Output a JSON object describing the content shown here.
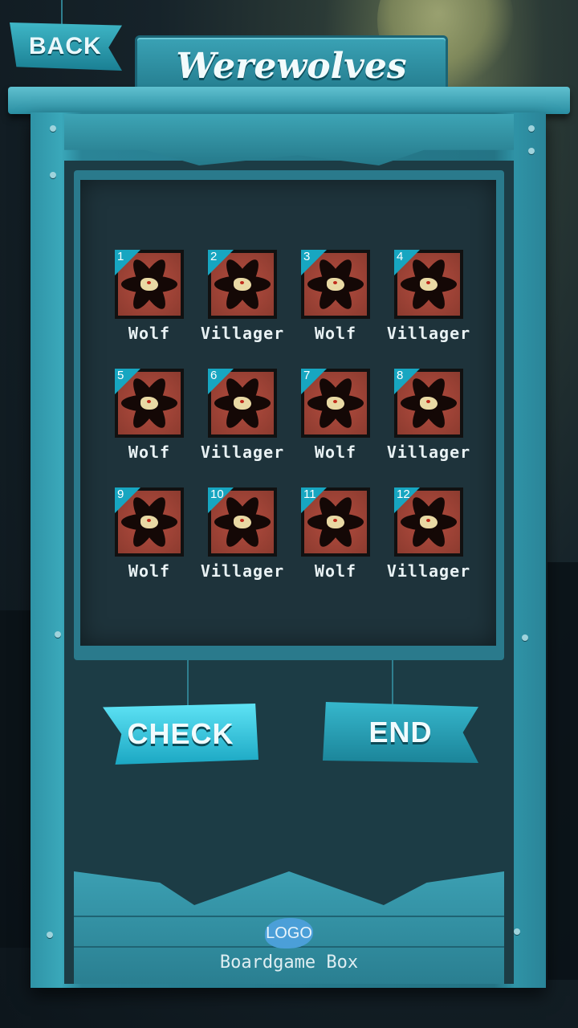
{
  "header": {
    "back_label": "BACK",
    "title": "Werewolves"
  },
  "cards": [
    {
      "number": "1",
      "role": "Wolf"
    },
    {
      "number": "2",
      "role": "Villager"
    },
    {
      "number": "3",
      "role": "Wolf"
    },
    {
      "number": "4",
      "role": "Villager"
    },
    {
      "number": "5",
      "role": "Wolf"
    },
    {
      "number": "6",
      "role": "Villager"
    },
    {
      "number": "7",
      "role": "Wolf"
    },
    {
      "number": "8",
      "role": "Villager"
    },
    {
      "number": "9",
      "role": "Wolf"
    },
    {
      "number": "10",
      "role": "Villager"
    },
    {
      "number": "11",
      "role": "Wolf"
    },
    {
      "number": "12",
      "role": "Villager"
    }
  ],
  "actions": {
    "check_label": "CHECK",
    "end_label": "END"
  },
  "footer": {
    "logo_text": "LOGO",
    "brand": "Boardgame Box"
  },
  "colors": {
    "accent": "#17a6c1",
    "wood": "#2f93a6",
    "panel": "#1e333b"
  }
}
